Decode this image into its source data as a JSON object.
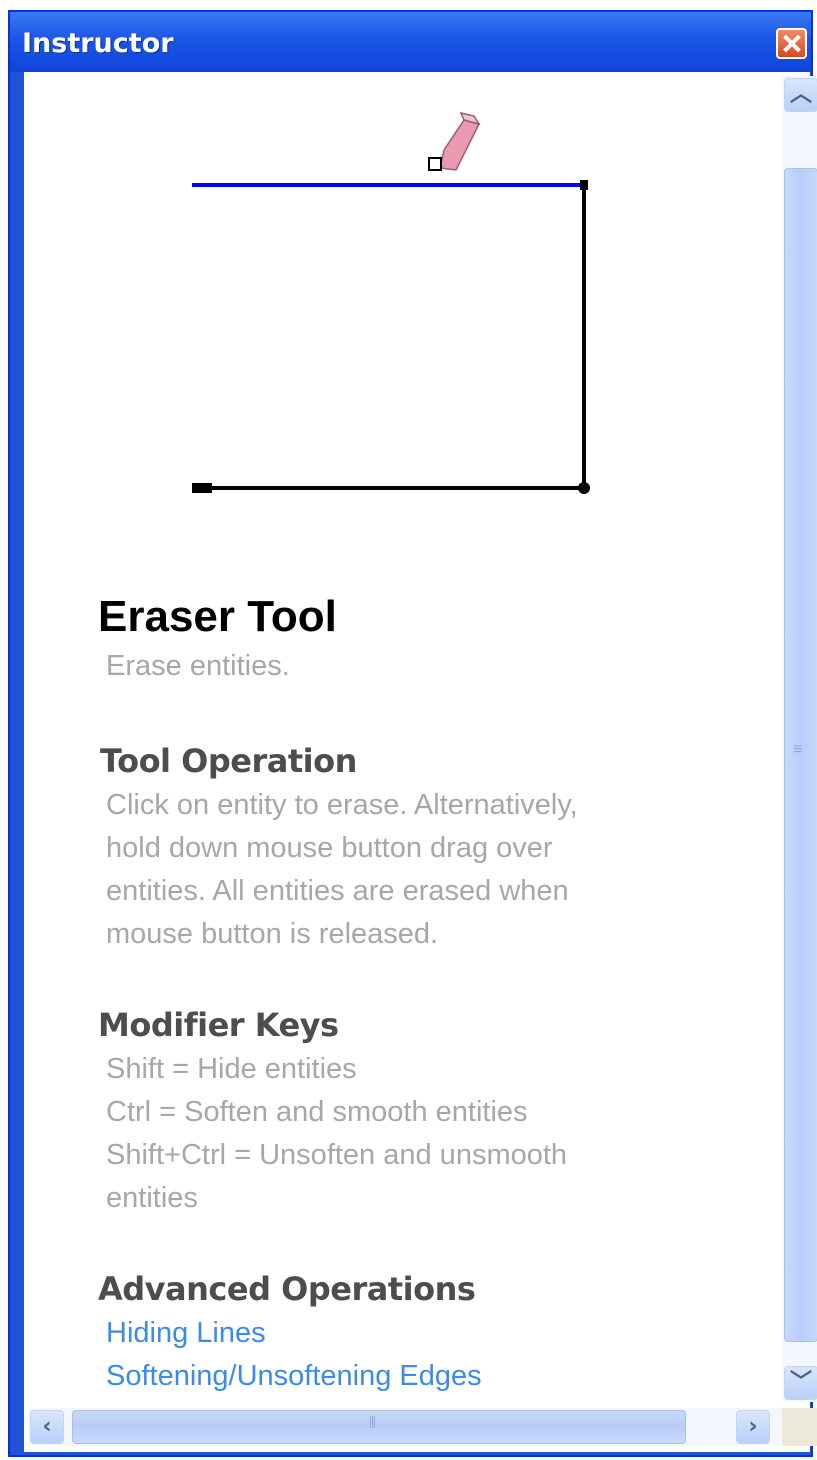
{
  "window": {
    "title": "Instructor"
  },
  "tool": {
    "name": "Eraser Tool",
    "description": "Erase entities."
  },
  "sections": {
    "operation": {
      "heading": "Tool Operation",
      "lines": [
        "Click on entity to erase. Alternatively,",
        "hold down mouse button drag over",
        "entities. All entities are erased when",
        "mouse button is released."
      ]
    },
    "modifiers": {
      "heading": "Modifier Keys",
      "lines": [
        "Shift = Hide entities",
        "Ctrl = Soften and smooth entities",
        "Shift+Ctrl = Unsoften and unsmooth",
        "entities"
      ]
    },
    "advanced": {
      "heading": "Advanced Operations",
      "links": [
        "Hiding Lines",
        "Softening/Unsoftening Edges"
      ]
    }
  },
  "colors": {
    "titlebar": "#1b56e6",
    "link": "#3c8be8",
    "highlight_edge": "#0000ff",
    "eraser": "#e79ab0"
  },
  "icons": {
    "close": "close-icon",
    "scroll_up": "arrow-up-icon",
    "scroll_down": "arrow-down-icon",
    "scroll_left": "arrow-left-icon",
    "scroll_right": "arrow-right-icon",
    "eraser": "eraser-icon"
  }
}
